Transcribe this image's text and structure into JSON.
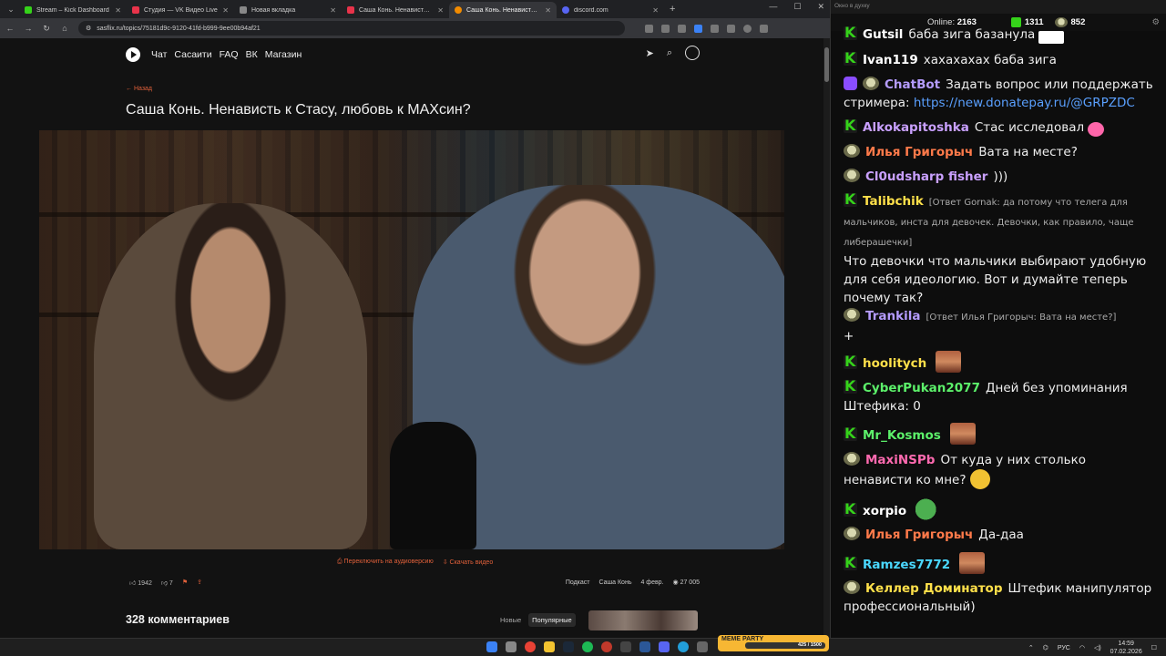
{
  "browser": {
    "tabs": [
      {
        "label": "Stream – Kick Dashboard",
        "color": "#35d21a"
      },
      {
        "label": "Студия — VK Видео Live",
        "color": "#e8334a"
      },
      {
        "label": "Новая вкладка",
        "color": "#888888"
      },
      {
        "label": "Саша Конь. Ненависть к Стасу",
        "color": "#e8334a"
      },
      {
        "label": "Саша Конь. Ненависть к С…",
        "color": "#f28b00"
      },
      {
        "label": "discord.com",
        "color": "#5865f2"
      }
    ],
    "url": "sasflix.ru/topics/75181d9c-9120-41fd-b999-9ee00b94af21"
  },
  "site": {
    "nav": [
      "Чат",
      "Сасаити",
      "FAQ",
      "ВК",
      "Магазин"
    ],
    "back": "← Назад",
    "title": "Саша Конь. Ненависть к Стасу, любовь к МАХсин?",
    "audio_link": "⎙ Переключить на аудиоверсию",
    "download_link": "⇩ Скачать видео",
    "likes": "1942",
    "dislikes": "7",
    "tag1": "Подкаст",
    "tag2": "Саша Конь",
    "date": "4 февр.",
    "views": "27 005",
    "comments_title": "328 комментариев",
    "sort_new": "Новые",
    "sort_popular": "Популярные"
  },
  "chat": {
    "window_title": "Окно в духку",
    "online_label": "Online:",
    "online_value": "2163",
    "kick_count": "1311",
    "vk_count": "852",
    "messages": [
      {
        "user": "Gutsil",
        "color": "#ffffff",
        "text": "баба зига базанула"
      },
      {
        "user": "Ivan119",
        "color": "#ffffff",
        "text": "хахахахах баба зига"
      },
      {
        "user": "ChatBot",
        "color": "#b59cff",
        "text": "Задать вопрос или поддержать стримера: ",
        "link": "https://new.donatepay.ru/@GRPZDC"
      },
      {
        "user": "Alkokapitoshka",
        "color": "#c9a0ff",
        "text": "Стас исследовал"
      },
      {
        "user": "Илья Григорыч",
        "color": "#ff7a4a",
        "text": "Вата на месте?"
      },
      {
        "user": "Cl0udsharp fisher",
        "color": "#c9a0ff",
        "text": ")))"
      },
      {
        "user": "Talibchik",
        "color": "#ffe04a",
        "reply": "[Ответ Gornak: да потому что телега для мальчиков, инста для девочек. Девочки, как правило, чаще либерашечки]",
        "text": "Что девочки что мальчики выбирают удобную для себя идеологию. Вот и думайте теперь почему так?"
      },
      {
        "user": "Trankila",
        "color": "#b59cff",
        "reply": "[Ответ Илья Григорыч: Вата на месте?]",
        "text": "+"
      },
      {
        "user": "hoolitych",
        "color": "#ffe04a",
        "text": ""
      },
      {
        "user": "CyberPukan2077",
        "color": "#5cf06a",
        "text": "Дней без упоминания Штефика: 0"
      },
      {
        "user": "Mr_Kosmos",
        "color": "#5cf06a",
        "text": ""
      },
      {
        "user": "MaxiNSPb",
        "color": "#ff6ab0",
        "text": "От куда у них столько ненависти ко мне?"
      },
      {
        "user": "xorpio",
        "color": "#ffffff",
        "text": ""
      },
      {
        "user": "Илья Григорыч",
        "color": "#ff7a4a",
        "text": "Да-даа"
      },
      {
        "user": "Ramzes7772",
        "color": "#4ad8ff",
        "text": ""
      },
      {
        "user": "Келлер Доминатор",
        "color": "#ffe04a",
        "text": "Штефик манипулятор профессиональный)"
      }
    ]
  },
  "taskbar": {
    "meme_title": "MEME PARTY",
    "meme_progress": "425 / 1500",
    "lang": "РУС",
    "time": "14:59",
    "date": "07.02.2026"
  }
}
